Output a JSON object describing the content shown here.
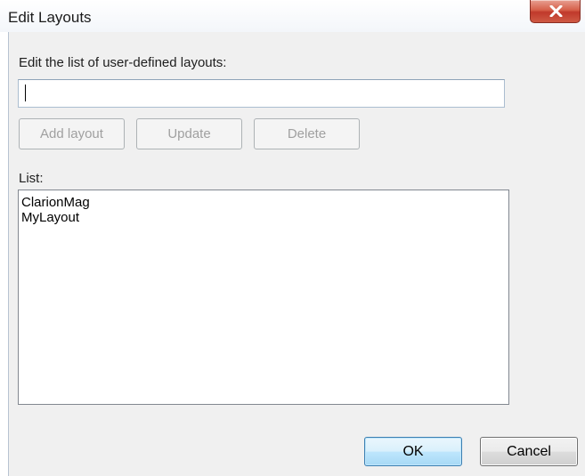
{
  "window": {
    "title": "Edit Layouts",
    "close_icon": "close-icon"
  },
  "form": {
    "prompt_label": "Edit the list of user-defined layouts:",
    "layout_name_value": "",
    "buttons": {
      "add": "Add layout",
      "update": "Update",
      "delete": "Delete"
    },
    "list_label": "List:",
    "list_items": [
      "ClarionMag",
      "MyLayout"
    ]
  },
  "dialog_buttons": {
    "ok": "OK",
    "cancel": "Cancel"
  },
  "colors": {
    "close_button": "#c0392b",
    "default_button_border": "#3c7fb1",
    "disabled_text": "#a0a0a0"
  }
}
